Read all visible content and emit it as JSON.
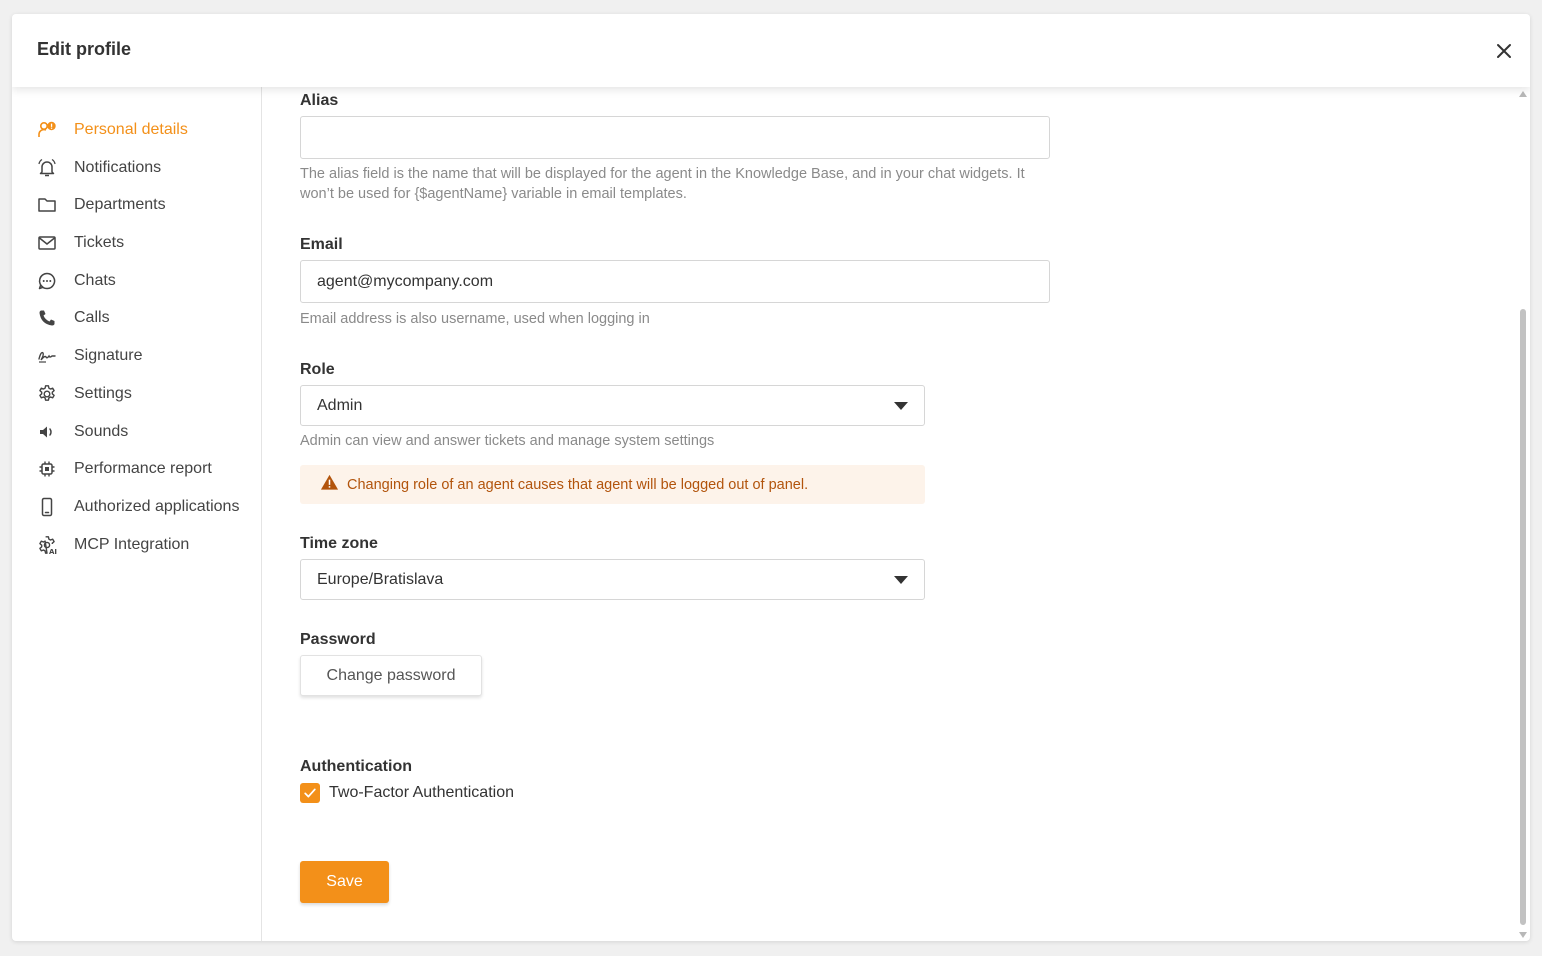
{
  "modal": {
    "title": "Edit profile",
    "close_icon": "close-icon"
  },
  "colors": {
    "accent": "#f39019",
    "warning_bg": "#fdf3ea",
    "warning_text": "#b2540c"
  },
  "sidebar": {
    "items": [
      {
        "label": "Personal details",
        "icon": "person-info-icon",
        "active": true
      },
      {
        "label": "Notifications",
        "icon": "bell-icon"
      },
      {
        "label": "Departments",
        "icon": "folder-icon"
      },
      {
        "label": "Tickets",
        "icon": "envelope-icon"
      },
      {
        "label": "Chats",
        "icon": "chat-bubble-icon"
      },
      {
        "label": "Calls",
        "icon": "phone-icon"
      },
      {
        "label": "Signature",
        "icon": "signature-icon"
      },
      {
        "label": "Settings",
        "icon": "gear-icon"
      },
      {
        "label": "Sounds",
        "icon": "speaker-icon"
      },
      {
        "label": "Performance report",
        "icon": "chip-icon"
      },
      {
        "label": "Authorized applications",
        "icon": "mobile-icon"
      },
      {
        "label": "MCP Integration",
        "icon": "gear-ai-icon"
      }
    ]
  },
  "form": {
    "alias": {
      "label": "Alias",
      "value": "",
      "help": "The alias field is the name that will be displayed for the agent in the Knowledge Base, and in your chat widgets. It won’t be used for {$agentName} variable in email templates."
    },
    "email": {
      "label": "Email",
      "value": "agent@mycompany.com",
      "help": "Email address is also username, used when logging in"
    },
    "role": {
      "label": "Role",
      "value": "Admin",
      "help": "Admin can view and answer tickets and manage system settings",
      "warning": "Changing role of an agent causes that agent will be logged out of panel."
    },
    "timezone": {
      "label": "Time zone",
      "value": "Europe/Bratislava"
    },
    "password": {
      "label": "Password",
      "button": "Change password"
    },
    "authentication": {
      "label": "Authentication",
      "two_factor_label": "Two-Factor Authentication",
      "two_factor_checked": true
    },
    "save_label": "Save"
  }
}
